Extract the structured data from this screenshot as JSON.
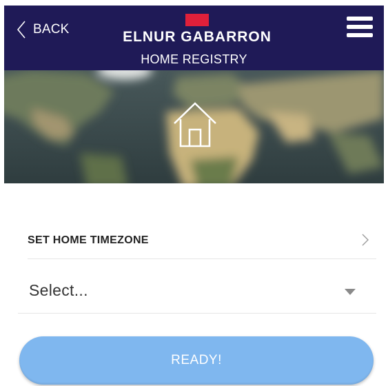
{
  "header": {
    "back_label": "BACK",
    "brand_name": "ELNUR GABARRON",
    "subtitle": "HOME REGISTRY"
  },
  "section": {
    "title": "SET HOME TIMEZONE"
  },
  "timezone_select": {
    "value": "Select..."
  },
  "ready_button": {
    "label": "READY!"
  },
  "colors": {
    "header_bg": "#1f1a57",
    "brand_mark": "#e0203a",
    "button_bg": "#7fb7ef"
  },
  "icons": {
    "back": "chevron-left-icon",
    "menu": "hamburger-menu-icon",
    "home": "house-icon",
    "section": "chevron-right-icon",
    "select": "caret-down-icon"
  }
}
